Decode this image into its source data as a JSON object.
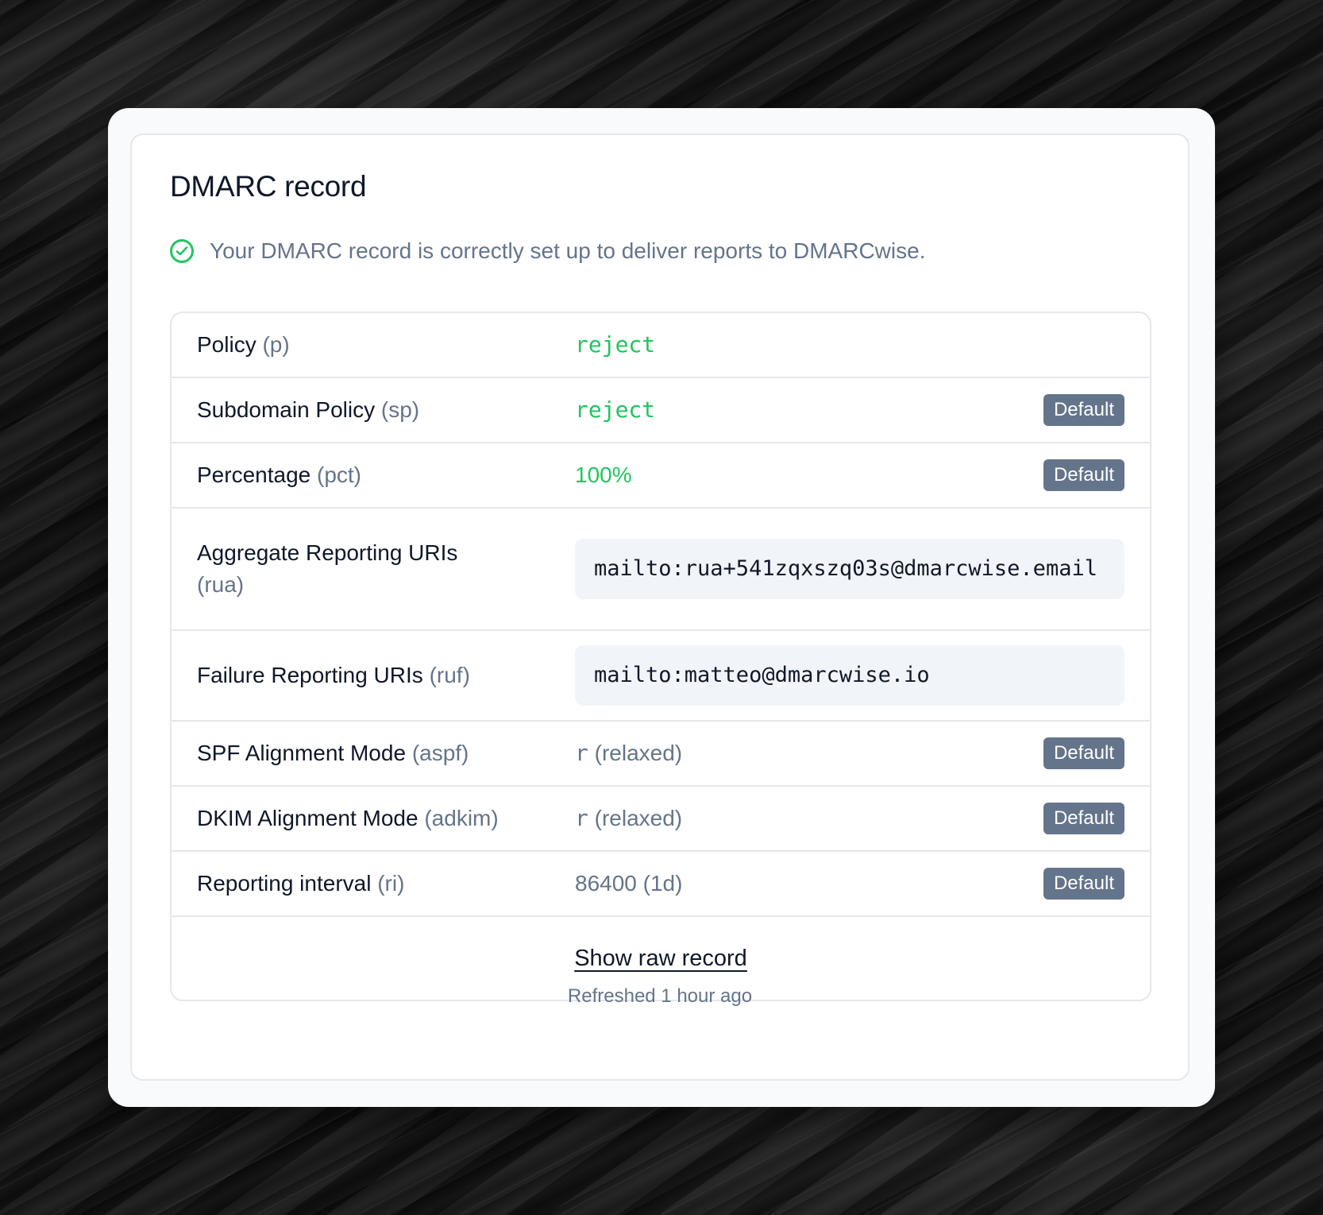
{
  "card": {
    "title": "DMARC record",
    "status_text": "Your DMARC record is correctly set up to deliver reports to DMARCwise.",
    "status_color": "#22c55e"
  },
  "rows": [
    {
      "label": "Policy",
      "code": "(p)",
      "value": "reject",
      "badge": ""
    },
    {
      "label": "Subdomain Policy",
      "code": "(sp)",
      "value": "reject",
      "badge": "Default"
    },
    {
      "label": "Percentage",
      "code": "(pct)",
      "value": "100%",
      "badge": "Default"
    },
    {
      "label": "Aggregate Reporting URIs",
      "code": "(rua)",
      "value": "mailto:rua+541zqxszq03s@dmarcwise.email",
      "badge": ""
    },
    {
      "label": "Failure Reporting URIs",
      "code": "(ruf)",
      "value": "mailto:matteo@dmarcwise.io",
      "badge": ""
    },
    {
      "label": "SPF Alignment Mode",
      "code": "(aspf)",
      "value_code": "r",
      "value_desc": "(relaxed)",
      "badge": "Default"
    },
    {
      "label": "DKIM Alignment Mode",
      "code": "(adkim)",
      "value_code": "r",
      "value_desc": "(relaxed)",
      "badge": "Default"
    },
    {
      "label": "Reporting interval",
      "code": "(ri)",
      "value": "86400 (1d)",
      "badge": "Default"
    }
  ],
  "show_raw_label": "Show raw record",
  "refreshed_text": "Refreshed 1 hour ago"
}
